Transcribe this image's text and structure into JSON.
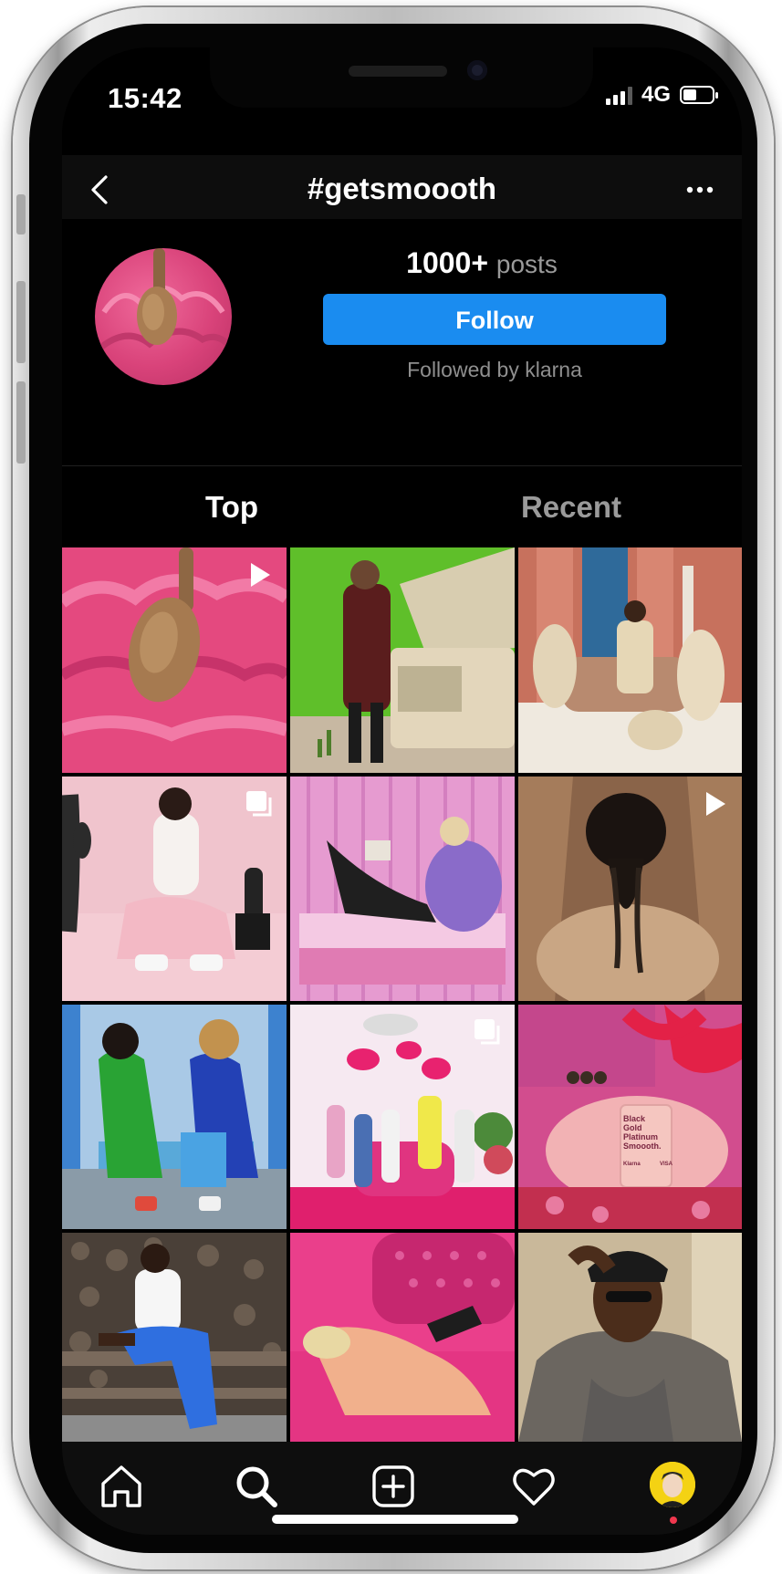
{
  "status_bar": {
    "time": "15:42",
    "network": "4G"
  },
  "header": {
    "title": "#getsmoooth",
    "back_icon": "chevron-left-icon",
    "more_icon": "more-horizontal-icon"
  },
  "hashtag": {
    "posts_count": "1000+",
    "posts_label": "posts",
    "follow_label": "Follow",
    "followed_by": "Followed by klarna"
  },
  "tabs": [
    {
      "label": "Top",
      "active": true
    },
    {
      "label": "Recent",
      "active": false
    }
  ],
  "grid": {
    "items": [
      {
        "scene": "pink-ice-cream-wooden-spoon",
        "badge": "video"
      },
      {
        "scene": "man-green-screen-truck",
        "badge": ""
      },
      {
        "scene": "man-sofa-afghan-hounds",
        "badge": ""
      },
      {
        "scene": "woman-pink-room-cactus",
        "badge": "carousel"
      },
      {
        "scene": "woman-lilac-fur-pink-table",
        "badge": ""
      },
      {
        "scene": "braided-hair-fur-coat",
        "badge": "video"
      },
      {
        "scene": "two-women-green-blue",
        "badge": ""
      },
      {
        "scene": "pillow-fight-pink-room",
        "badge": "carousel"
      },
      {
        "scene": "pink-card-fur-bow",
        "badge": ""
      },
      {
        "scene": "woman-blue-pants-bench",
        "badge": ""
      },
      {
        "scene": "woman-lying-pink-bed",
        "badge": ""
      },
      {
        "scene": "woman-cap-sunglasses",
        "badge": ""
      }
    ],
    "card_text": [
      "Black",
      "Gold",
      "Platinum",
      "Smoooth."
    ],
    "card_brand": "Klarna",
    "card_network": "VISA"
  },
  "tabbar": {
    "items": [
      "home-icon",
      "search-icon",
      "new-post-icon",
      "heart-icon",
      "profile-avatar"
    ]
  },
  "colors": {
    "accent": "#1a8cf0",
    "background": "#000000",
    "notification": "#f0374e"
  }
}
